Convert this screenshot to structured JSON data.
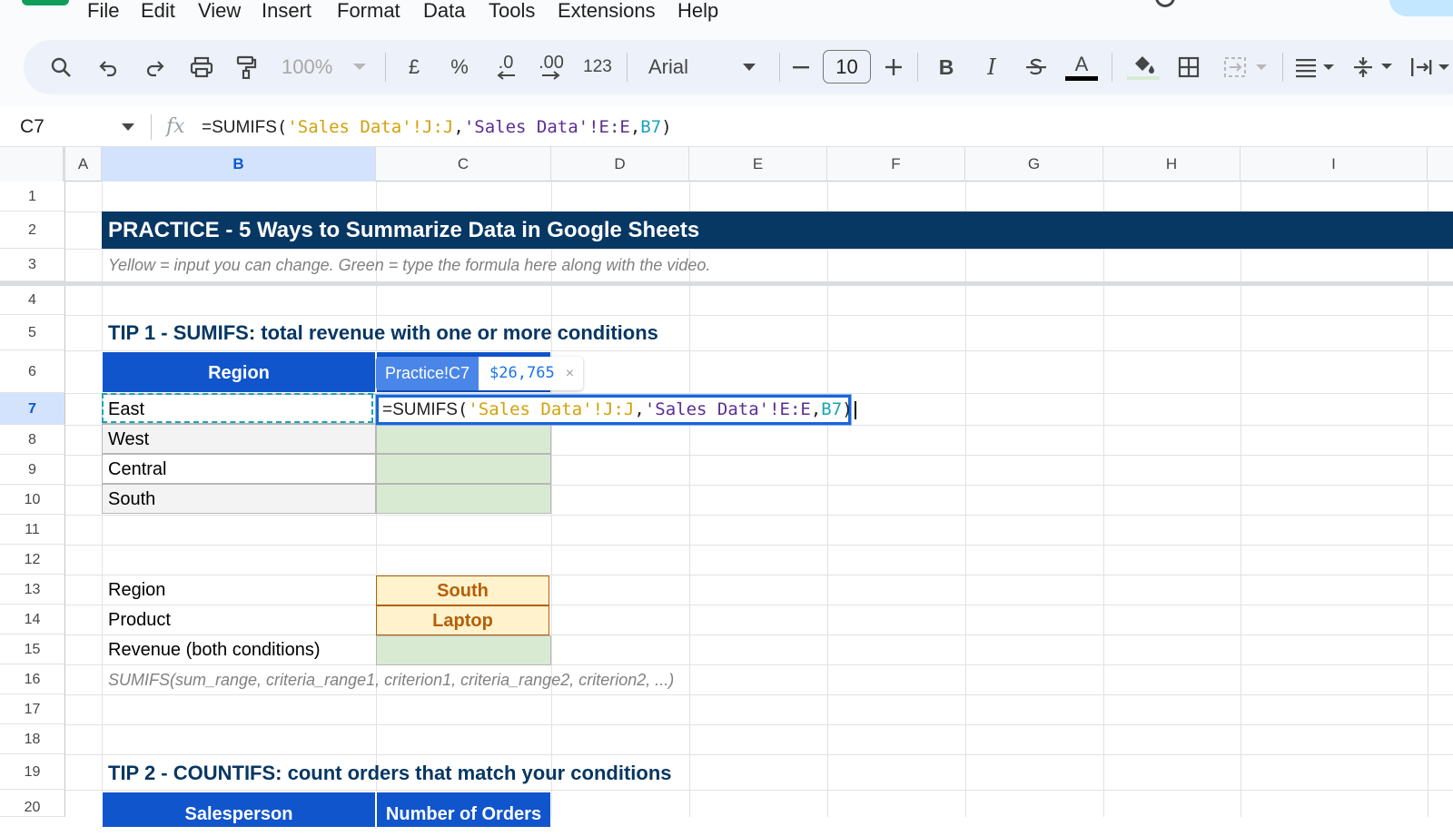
{
  "menu": {
    "items": [
      "File",
      "Edit",
      "View",
      "Insert",
      "Format",
      "Data",
      "Tools",
      "Extensions",
      "Help"
    ]
  },
  "toolbar": {
    "zoom": "100%",
    "currency_symbol": "£",
    "percent_symbol": "%",
    "decrease_decimals": ".0",
    "increase_decimals": ".00",
    "number_format": "123",
    "font_name": "Arial",
    "font_size": "10",
    "bold": "B",
    "italic": "I",
    "text_color": "A",
    "icons": [
      "search-icon",
      "undo-icon",
      "redo-icon",
      "print-icon",
      "paint-format-icon",
      "strikethrough-icon",
      "fill-color-icon",
      "borders-icon",
      "merge-cells-icon",
      "horizontal-align-icon",
      "vertical-align-icon",
      "text-wrap-icon"
    ]
  },
  "formula_bar": {
    "name_box": "C7",
    "fx": "fx",
    "formula": {
      "fn": "=SUMIFS",
      "open": "(",
      "range1": "'Sales Data'!J:J",
      "comma1": ",",
      "range2": "'Sales Data'!E:E",
      "comma2": ",",
      "ref": "B7",
      "close": ")"
    }
  },
  "columns": [
    "A",
    "B",
    "C",
    "D",
    "E",
    "F",
    "G",
    "H",
    "I"
  ],
  "selected_column": "B",
  "rows": [
    "1",
    "2",
    "3",
    "4",
    "5",
    "6",
    "7",
    "8",
    "9",
    "10",
    "11",
    "12",
    "13",
    "14",
    "15",
    "16",
    "17",
    "18",
    "19",
    "20"
  ],
  "selected_row": "7",
  "sheet": {
    "title": "PRACTICE  -  5 Ways to Summarize Data in Google Sheets",
    "subtitle": "Yellow = input you can change.  Green = type the formula here along with the video.",
    "tip1": {
      "heading": "TIP 1  -  SUMIFS: total revenue with one or more conditions",
      "table_header": "Region",
      "regions": [
        "East",
        "West",
        "Central",
        "South"
      ],
      "labels": {
        "region": "Region",
        "product": "Product",
        "revenue": "Revenue (both conditions)"
      },
      "inputs": {
        "region": "South",
        "product": "Laptop"
      },
      "syntax_hint": "SUMIFS(sum_range, criteria_range1, criterion1, criteria_range2, criterion2, ...)"
    },
    "tip2": {
      "heading": "TIP 2  -  COUNTIFS: count orders that match your conditions",
      "table_headers": [
        "Salesperson",
        "Number of Orders"
      ]
    }
  },
  "editor": {
    "tooltip_ref": "Practice!C7",
    "tooltip_value": "$26,765",
    "tooltip_close": "×"
  },
  "colors": {
    "title_banner": "#073763",
    "table_header": "#1155cc",
    "input_green": "#d9ead3",
    "input_yellow": "#fff2cc",
    "accent_blue": "#1a66d2"
  }
}
